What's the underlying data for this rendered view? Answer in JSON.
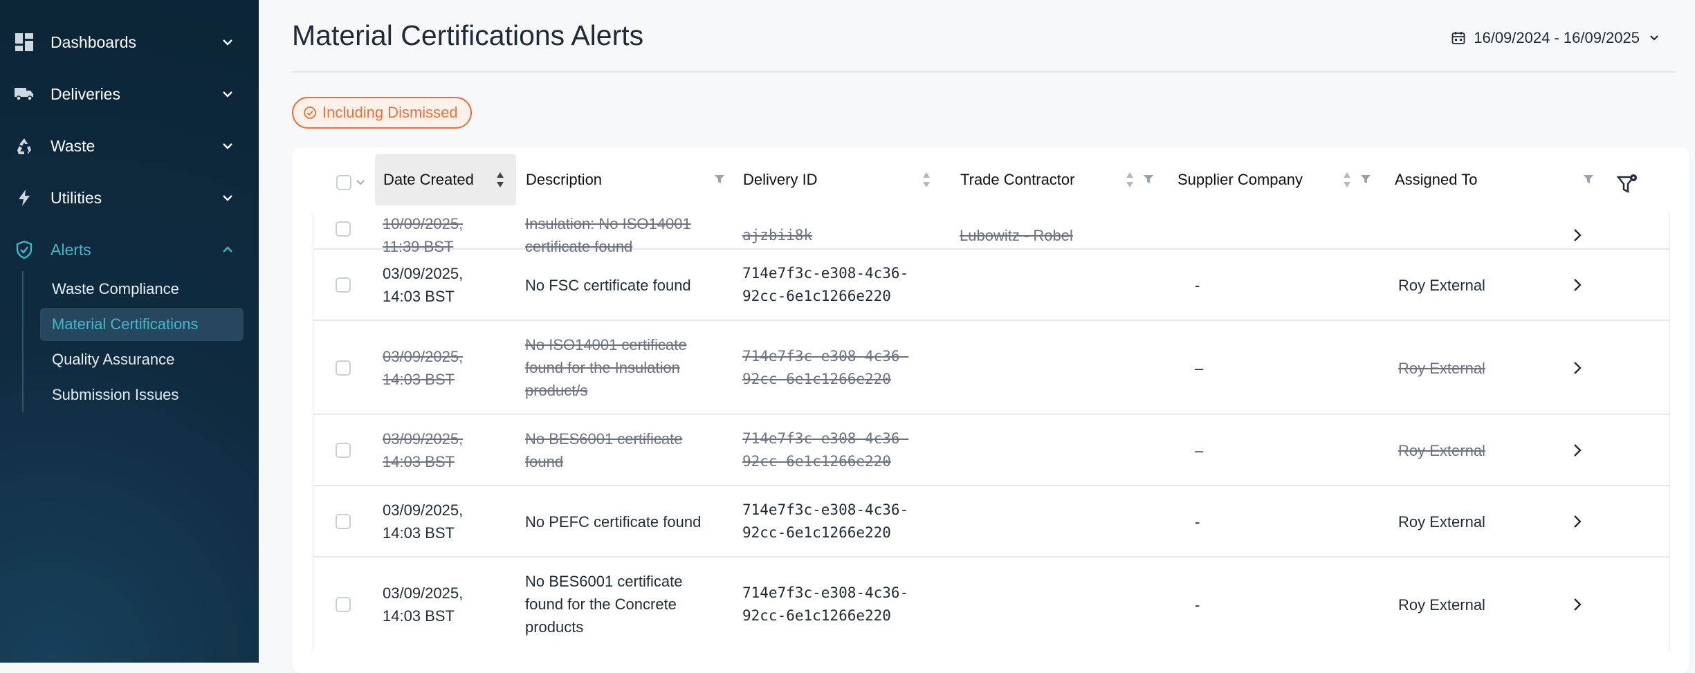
{
  "sidebar": {
    "groups": [
      {
        "label": "Dashboards",
        "icon": "grid-icon",
        "expanded": false
      },
      {
        "label": "Deliveries",
        "icon": "truck-icon",
        "expanded": false
      },
      {
        "label": "Waste",
        "icon": "recycle-icon",
        "expanded": false
      },
      {
        "label": "Utilities",
        "icon": "lightning-icon",
        "expanded": false
      },
      {
        "label": "Alerts",
        "icon": "shield-check-icon",
        "expanded": true
      }
    ],
    "alerts_subitems": [
      {
        "label": "Waste Compliance",
        "active": false
      },
      {
        "label": "Material Certifications",
        "active": true
      },
      {
        "label": "Quality Assurance",
        "active": false
      },
      {
        "label": "Submission Issues",
        "active": false
      }
    ],
    "accent_color": "#3fb8c9"
  },
  "header": {
    "title": "Material Certifications Alerts",
    "date_range": "16/09/2024 - 16/09/2025"
  },
  "filter_chip": {
    "label": "Including Dismissed",
    "color": "#e8703a"
  },
  "table": {
    "columns": [
      {
        "label": "Date Created",
        "sorted": true
      },
      {
        "label": "Description"
      },
      {
        "label": "Delivery ID"
      },
      {
        "label": "Trade Contractor"
      },
      {
        "label": "Supplier Company"
      },
      {
        "label": "Assigned To"
      }
    ],
    "rows": [
      {
        "dismissed": true,
        "date": "10/09/2025,",
        "time": "11:39 BST",
        "description": [
          "Insulation: No ISO14001",
          "certificate found"
        ],
        "delivery_id": [
          "ajzbii8k"
        ],
        "trade_contractor": "Lubowitz - Robel",
        "supplier": "",
        "assigned": ""
      },
      {
        "dismissed": false,
        "date": "03/09/2025,",
        "time": "14:03 BST",
        "description": [
          "No FSC certificate found"
        ],
        "delivery_id": [
          "714e7f3c-e308-4c36-",
          "92cc-6e1c1266e220"
        ],
        "trade_contractor": "",
        "supplier": "-",
        "assigned": "Roy External"
      },
      {
        "dismissed": true,
        "date": "03/09/2025,",
        "time": "14:03 BST",
        "description": [
          "No ISO14001 certificate",
          "found for the Insulation",
          "product/s"
        ],
        "delivery_id": [
          "714e7f3c-e308-4c36-",
          "92cc-6e1c1266e220"
        ],
        "trade_contractor": "",
        "supplier": "–",
        "assigned": "Roy External"
      },
      {
        "dismissed": true,
        "date": "03/09/2025,",
        "time": "14:03 BST",
        "description": [
          "No BES6001 certificate",
          "found"
        ],
        "delivery_id": [
          "714e7f3c-e308-4c36-",
          "92cc-6e1c1266e220"
        ],
        "trade_contractor": "",
        "supplier": "–",
        "assigned": "Roy External"
      },
      {
        "dismissed": false,
        "date": "03/09/2025,",
        "time": "14:03 BST",
        "description": [
          "No PEFC certificate found"
        ],
        "delivery_id": [
          "714e7f3c-e308-4c36-",
          "92cc-6e1c1266e220"
        ],
        "trade_contractor": "",
        "supplier": "-",
        "assigned": "Roy External"
      },
      {
        "dismissed": false,
        "date": "03/09/2025,",
        "time": "14:03 BST",
        "description": [
          "No BES6001 certificate",
          "found for the Concrete",
          "products"
        ],
        "delivery_id": [
          "714e7f3c-e308-4c36-",
          "92cc-6e1c1266e220"
        ],
        "trade_contractor": "",
        "supplier": "-",
        "assigned": "Roy External"
      }
    ]
  }
}
